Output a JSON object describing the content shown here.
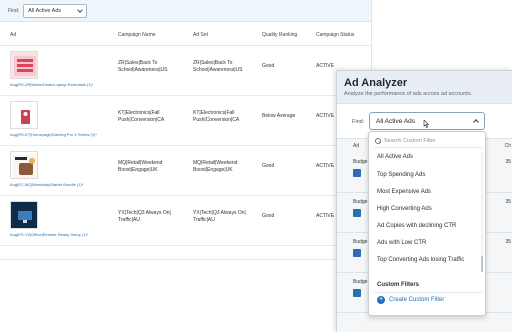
{
  "background_table": {
    "find_label": "Find:",
    "filter_value": "All Active Ads",
    "headers": {
      "ad": "Ad",
      "campaign_name": "Campaign Name",
      "ad_set": "Ad Set",
      "quality_ranking": "Quality Ranking",
      "campaign_status": "Campaign Status"
    },
    "rows": [
      {
        "ad_name": "Aug|RS-ZR|WinterDeals:Laptop Essentials (1)*",
        "campaign_line1": "ZR|Sales|Back To",
        "campaign_line2": "School|Awareness|US",
        "adset_line1": "ZR|Sales|Back To",
        "adset_line2": "School|Awareness|US",
        "quality": "Good",
        "status": "ACTIVE"
      },
      {
        "ad_name": "Aug|RS-KT|Homepage|Gaming Pro X Series (1)*",
        "campaign_line1": "KT|Electronics|Fall",
        "campaign_line2": "Push|Conversion|CA",
        "adset_line1": "KT|Electronics|Fall",
        "adset_line2": "Push|Conversion|CA",
        "quality": "Below Average",
        "status": "ACTIVE"
      },
      {
        "ad_name": "Aug|EC-MQ|Weekday|Starter Bundle (1)*",
        "campaign_line1": "MQ|Retail|Weekend",
        "campaign_line2": "Boost|Engage|UK",
        "adset_line1": "MQ|Retail|Weekend",
        "adset_line2": "Boost|Engage|UK",
        "quality": "Good",
        "status": "ACTIVE"
      },
      {
        "ad_name": "Aug|ES-YX|Office|Remote Ready Setup (1)*",
        "campaign_line1": "YX|Tech|Q3 Always On|",
        "campaign_line2": "Traffic|AU",
        "adset_line1": "YX|Tech|Q3 Always On|",
        "adset_line2": "Traffic|AU",
        "quality": "Good",
        "status": "ACTIVE"
      }
    ]
  },
  "ad_analyzer": {
    "title": "Ad Analyzer",
    "subtitle": "Analyze the performance of ads across ad accounts.",
    "find_label": "Find:",
    "selected_filter": "All Active Ads",
    "column_ad": "Ad",
    "column_ch": "Ch",
    "row_budget_label": "Budge",
    "row_numbers": [
      "35",
      "35",
      "35"
    ]
  },
  "dropdown": {
    "search_placeholder": "Search Custom Filter",
    "options": [
      "All Active Ads",
      "Top Spending Ads",
      "Most Expensive Ads",
      "High Converting Ads",
      "Ad Copies with declining CTR",
      "Ads with Low CTR",
      "Top Converting Ads losing Traffic"
    ],
    "custom_filters_heading": "Custom Filters",
    "create_custom_filter": "Create Custom Filter"
  },
  "colors": {
    "accent_blue": "#1f6ec1",
    "panel_bg": "#e8eef3",
    "filterbar_bg": "#eef6fc"
  }
}
